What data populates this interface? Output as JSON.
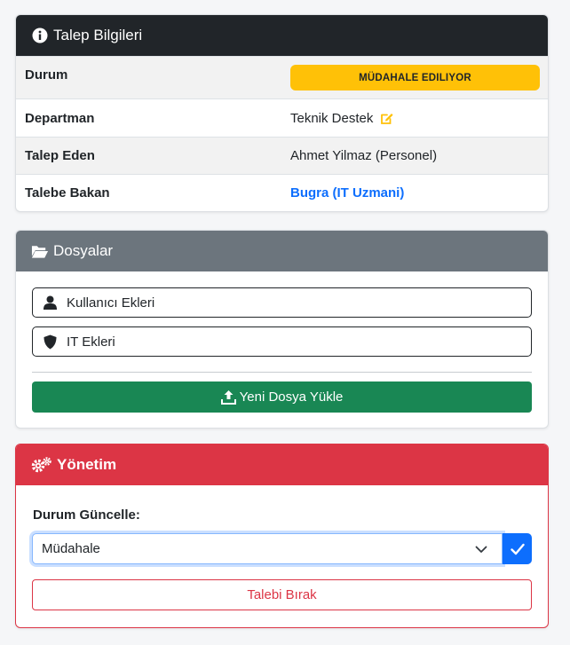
{
  "info_card": {
    "title": "Talep Bilgileri",
    "icon": "info-circle-icon",
    "rows": [
      {
        "label": "Durum",
        "value": "MÜDAHALE EDILIYOR"
      },
      {
        "label": "Departman",
        "value": "Teknik Destek"
      },
      {
        "label": "Talep Eden",
        "value": "Ahmet Yilmaz (Personel)"
      },
      {
        "label": "Talebe Bakan",
        "value": "Bugra (IT Uzmani)"
      }
    ]
  },
  "files_card": {
    "title": "Dosyalar",
    "icon": "folder-open-icon",
    "user_attachments": "Kullanıcı Ekleri",
    "it_attachments": "IT Ekleri",
    "upload_label": "Yeni Dosya Yükle"
  },
  "admin_card": {
    "title": "Yönetim",
    "icon": "gears-icon",
    "status_label": "Durum Güncelle:",
    "selected_status": "Müdahale",
    "release_label": "Talebi Bırak"
  },
  "colors": {
    "dark_header": "#212529",
    "gray_header": "#6c757d",
    "danger": "#dc3545",
    "warning": "#ffc107",
    "success": "#198754",
    "primary": "#0d6efd"
  }
}
